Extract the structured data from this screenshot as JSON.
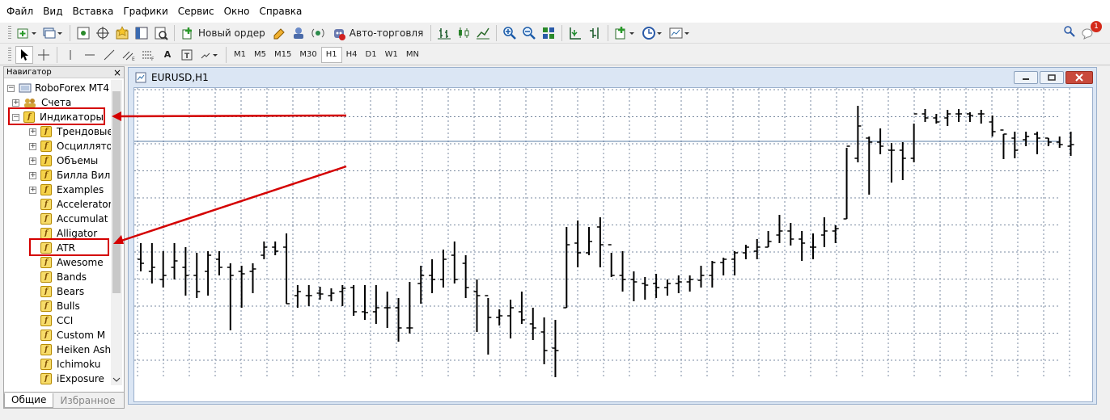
{
  "menu": [
    "Файл",
    "Вид",
    "Вставка",
    "Графики",
    "Сервис",
    "Окно",
    "Справка"
  ],
  "toolbar": {
    "new_order_label": "Новый ордер",
    "autotrade_label": "Авто-торговля",
    "icons": [
      "new-chart-icon",
      "profiles-icon",
      "market-watch-icon",
      "data-window-icon",
      "navigator-icon",
      "terminal-icon",
      "tester-icon",
      "new-order-icon",
      "metaeditor-icon",
      "options-icon",
      "autotrade-icon",
      "bar-chart-icon",
      "candles-icon",
      "line-chart-icon",
      "zoom-in-icon",
      "zoom-out-icon",
      "tile-icon",
      "autoscroll-icon",
      "chart-shift-icon",
      "indicators-icon",
      "periods-icon",
      "templates-icon",
      "search-icon",
      "notifications-icon"
    ],
    "notification_count": "1"
  },
  "drawing_toolbar": {
    "text_tool": "A",
    "timeframes": [
      "M1",
      "M5",
      "M15",
      "M30",
      "H1",
      "H4",
      "D1",
      "W1",
      "MN"
    ],
    "active_timeframe": "H1"
  },
  "navigator": {
    "title": "Навигатор",
    "close": "×",
    "root": "RoboForex MT4",
    "accounts": "Счета",
    "indicators": "Индикаторы",
    "folders": [
      "Трендовые",
      "Осциллято",
      "Объемы",
      "Билла Вил",
      "Examples"
    ],
    "items": [
      "Accelerator",
      "Accumulat",
      "Alligator",
      "ATR",
      "Awesome",
      "Bands",
      "Bears",
      "Bulls",
      "CCI",
      "Custom M",
      "Heiken Ash",
      "Ichimoku",
      "iExposure"
    ],
    "tabs": [
      "Общие",
      "Избранное"
    ]
  },
  "chart": {
    "title": "EURUSD,H1",
    "colors": {
      "bars": "#000000",
      "grid": "#7a8aa0",
      "hline": "#5a7ca6",
      "highlight": "#d40000"
    }
  },
  "chart_data": {
    "type": "bar",
    "symbol": "EURUSD",
    "timeframe": "H1",
    "bars": [
      [
        320,
        300,
        335,
        325
      ],
      [
        335,
        300,
        350,
        330
      ],
      [
        345,
        310,
        355,
        340
      ],
      [
        330,
        300,
        345,
        322
      ],
      [
        330,
        305,
        365,
        340
      ],
      [
        340,
        312,
        368,
        360
      ],
      [
        335,
        310,
        365,
        315
      ],
      [
        320,
        310,
        340,
        330
      ],
      [
        330,
        325,
        408,
        340
      ],
      [
        335,
        328,
        380,
        338
      ],
      [
        335,
        325,
        362,
        332
      ],
      [
        315,
        298,
        320,
        305
      ],
      [
        305,
        298,
        315,
        310
      ],
      [
        305,
        288,
        375,
        375
      ],
      [
        365,
        352,
        380,
        360
      ],
      [
        365,
        352,
        378,
        365
      ],
      [
        362,
        354,
        370,
        363
      ],
      [
        365,
        356,
        372,
        362
      ],
      [
        360,
        352,
        378,
        356
      ],
      [
        355,
        352,
        390,
        385
      ],
      [
        385,
        352,
        395,
        386
      ],
      [
        385,
        352,
        400,
        380
      ],
      [
        380,
        360,
        405,
        380
      ],
      [
        380,
        368,
        422,
        405
      ],
      [
        405,
        348,
        412,
        405
      ],
      [
        350,
        328,
        375,
        340
      ],
      [
        340,
        320,
        362,
        345
      ],
      [
        345,
        308,
        355,
        320
      ],
      [
        315,
        298,
        350,
        345
      ],
      [
        325,
        315,
        368,
        355
      ],
      [
        360,
        345,
        410,
        365
      ],
      [
        365,
        368,
        438,
        392
      ],
      [
        392,
        382,
        402,
        390
      ],
      [
        390,
        370,
        418,
        380
      ],
      [
        385,
        360,
        400,
        395
      ],
      [
        400,
        380,
        420,
        405
      ],
      [
        410,
        392,
        450,
        433
      ],
      [
        430,
        395,
        466,
        433
      ],
      [
        380,
        280,
        380,
        302
      ],
      [
        300,
        272,
        330,
        312
      ],
      [
        312,
        280,
        315,
        298
      ],
      [
        280,
        268,
        330,
        302
      ],
      [
        302,
        312,
        342,
        340
      ],
      [
        340,
        310,
        360,
        345
      ],
      [
        345,
        335,
        372,
        348
      ],
      [
        350,
        342,
        370,
        352
      ],
      [
        350,
        338,
        368,
        355
      ],
      [
        355,
        345,
        365,
        350
      ],
      [
        350,
        340,
        362,
        348
      ],
      [
        348,
        340,
        360,
        345
      ],
      [
        346,
        328,
        355,
        340
      ],
      [
        340,
        322,
        355,
        324
      ],
      [
        324,
        318,
        340,
        320
      ],
      [
        320,
        310,
        340,
        312
      ],
      [
        312,
        302,
        320,
        305
      ],
      [
        310,
        295,
        320,
        305
      ],
      [
        305,
        285,
        305,
        298
      ],
      [
        290,
        265,
        300,
        285
      ],
      [
        285,
        275,
        303,
        295
      ],
      [
        295,
        285,
        322,
        300
      ],
      [
        305,
        288,
        320,
        305
      ],
      [
        290,
        268,
        305,
        285
      ],
      [
        285,
        278,
        300,
        282
      ],
      [
        270,
        182,
        270,
        180
      ],
      [
        195,
        130,
        200,
        155
      ],
      [
        170,
        168,
        240,
        175
      ],
      [
        175,
        158,
        190,
        180
      ],
      [
        185,
        176,
        225,
        185
      ],
      [
        185,
        175,
        222,
        195
      ],
      [
        195,
        152,
        200,
        140
      ],
      [
        140,
        134,
        150,
        145
      ],
      [
        145,
        140,
        152,
        150
      ],
      [
        145,
        135,
        155,
        140
      ],
      [
        140,
        134,
        150,
        140
      ],
      [
        140,
        138,
        150,
        142
      ],
      [
        140,
        135,
        152,
        140
      ],
      [
        150,
        142,
        168,
        162
      ],
      [
        160,
        165,
        196,
        165
      ],
      [
        170,
        162,
        195,
        185
      ],
      [
        172,
        162,
        180,
        168
      ],
      [
        165,
        162,
        190,
        170
      ],
      [
        170,
        170,
        180,
        175
      ],
      [
        175,
        168,
        182,
        178
      ],
      [
        180,
        162,
        192,
        178
      ]
    ]
  }
}
